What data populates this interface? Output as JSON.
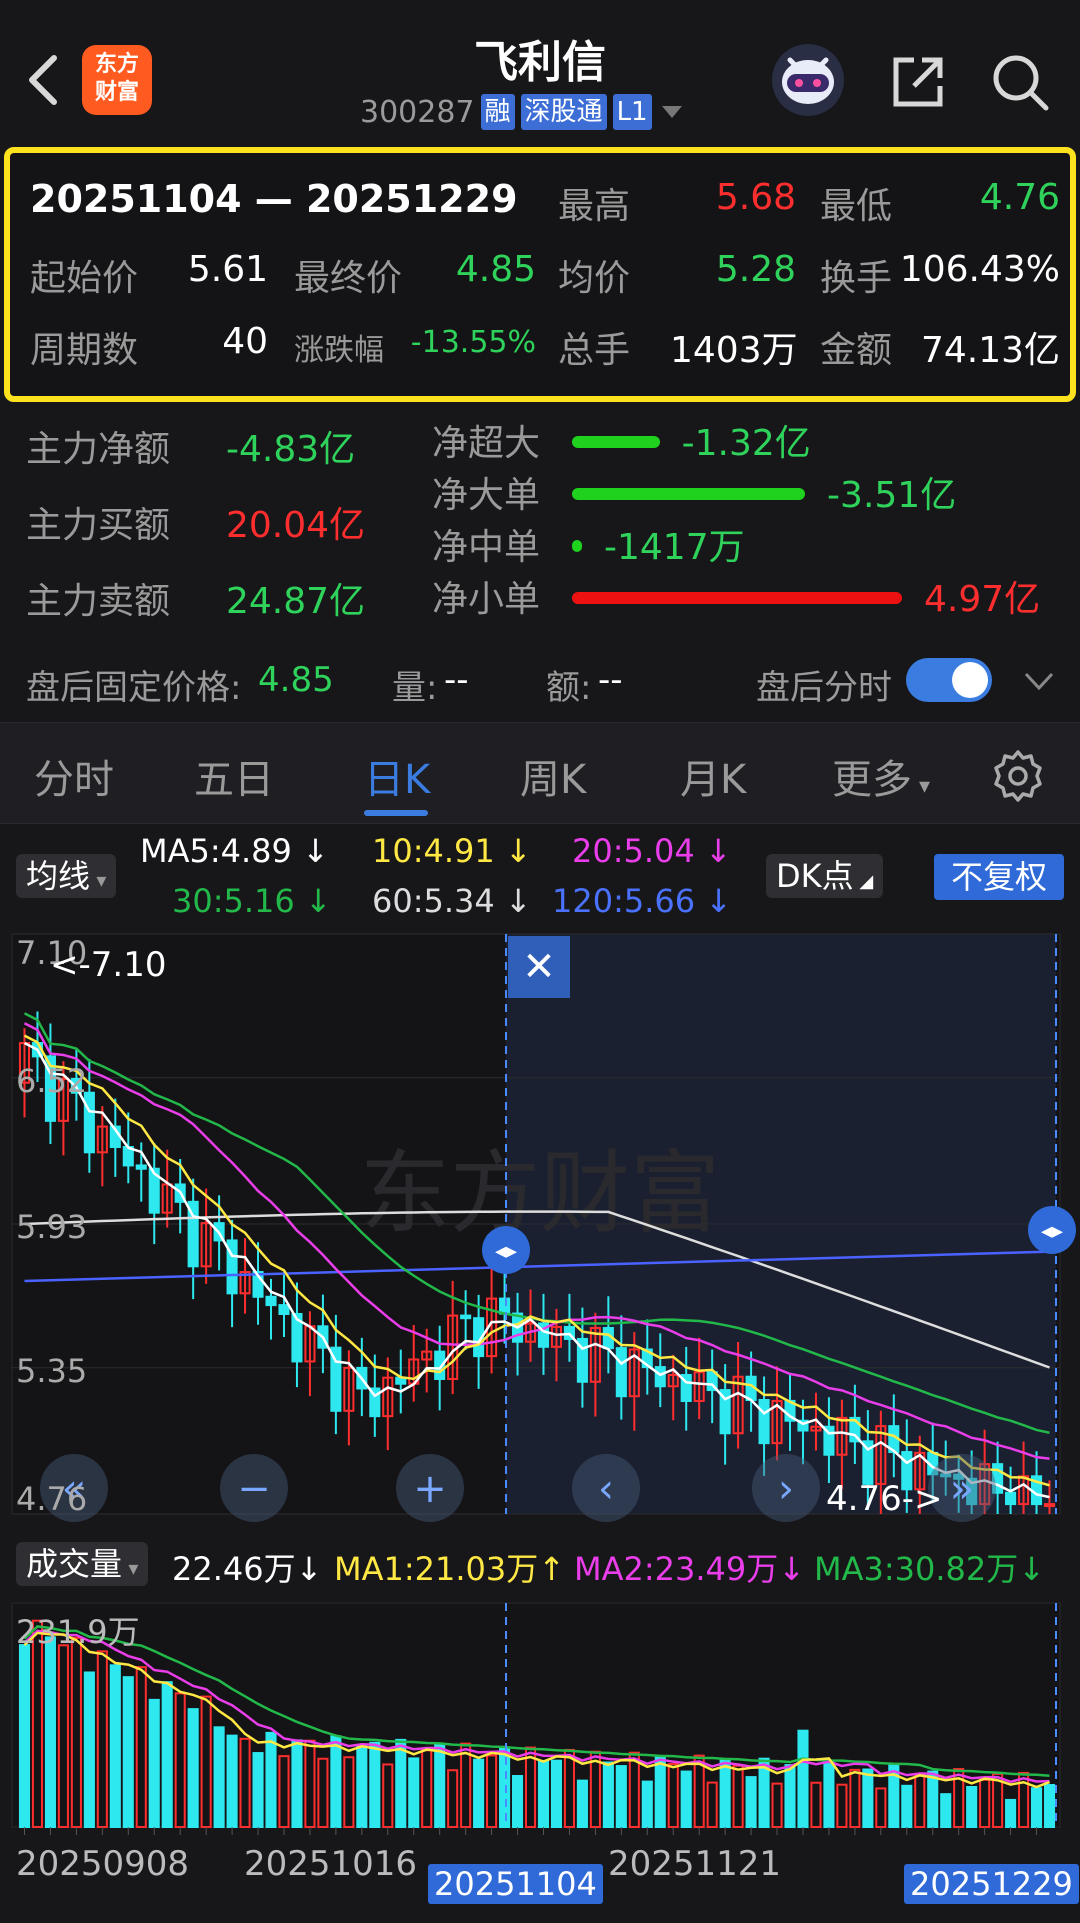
{
  "header": {
    "title": "飞利信",
    "code": "300287",
    "logo_line1": "东方",
    "logo_line2": "财富",
    "tags": [
      "融",
      "深股通",
      "L1"
    ]
  },
  "summary": {
    "range": "20251104 — 20251229",
    "high_label": "最高",
    "high": "5.68",
    "low_label": "最低",
    "low": "4.76",
    "open_label": "起始价",
    "open": "5.61",
    "close_label": "最终价",
    "close": "4.85",
    "avg_label": "均价",
    "avg": "5.28",
    "turnover_label": "换手",
    "turnover": "106.43%",
    "periods_label": "周期数",
    "periods": "40",
    "change_label": "涨跌幅",
    "change": "-13.55%",
    "volume_label": "总手",
    "volume": "1403万",
    "amount_label": "金额",
    "amount": "74.13亿"
  },
  "flow": {
    "net_label": "主力净额",
    "net": "-4.83亿",
    "buy_label": "主力买额",
    "buy": "20.04亿",
    "sell_label": "主力卖额",
    "sell": "24.87亿",
    "items": [
      {
        "label": "净超大",
        "value": "-1.32亿",
        "magnitude": 1.32,
        "color": "#1ed21e"
      },
      {
        "label": "净大单",
        "value": "-3.51亿",
        "magnitude": 3.51,
        "color": "#1ed21e"
      },
      {
        "label": "净中单",
        "value": "-1417万",
        "magnitude": 0.14,
        "color": "#1ed21e"
      },
      {
        "label": "净小单",
        "value": "4.97亿",
        "magnitude": 4.97,
        "color": "#ee1111"
      }
    ]
  },
  "after_hours": {
    "price_label": "盘后固定价格:",
    "price": "4.85",
    "vol_label": "量:",
    "vol": "--",
    "amt_label": "额:",
    "amt": "--",
    "toggle_label": "盘后分时"
  },
  "tabs": [
    "分时",
    "五日",
    "日K",
    "周K",
    "月K",
    "更多"
  ],
  "ma": {
    "selector": "均线",
    "ma5": "MA5:4.89",
    "ma10": "10:4.91",
    "ma20": "20:5.04",
    "ma30": "30:5.16",
    "ma60": "60:5.34",
    "ma120": "120:5.66",
    "dk": "DK点",
    "fq": "不复权"
  },
  "chart_data": {
    "type": "candlestick",
    "price_labels": [
      "7.10",
      "6.52",
      "5.93",
      "5.35",
      "4.76"
    ],
    "ylim": [
      4.76,
      7.1
    ],
    "max_marker": "<-7.10",
    "min_marker": "4.76->",
    "watermark": "东方财富",
    "colors": {
      "up": "#ff2e2e",
      "down": "#2ee8f0",
      "ma5": "#ffffff",
      "ma10": "#ffe844",
      "ma20": "#e93ee9",
      "ma30": "#22b84a",
      "ma60": "#dddddd",
      "ma120": "#4a62ff"
    },
    "volume": {
      "selector": "成交量",
      "current": "22.46万",
      "ma1": "MA1:21.03万",
      "ma2": "MA2:23.49万",
      "ma3": "MA3:30.82万",
      "max_label": "231.9万"
    },
    "dates": [
      "20250908",
      "20251016",
      "20251104",
      "20251121",
      "20251229"
    ],
    "selected_start": "20251104",
    "selected_end": "20251229"
  }
}
